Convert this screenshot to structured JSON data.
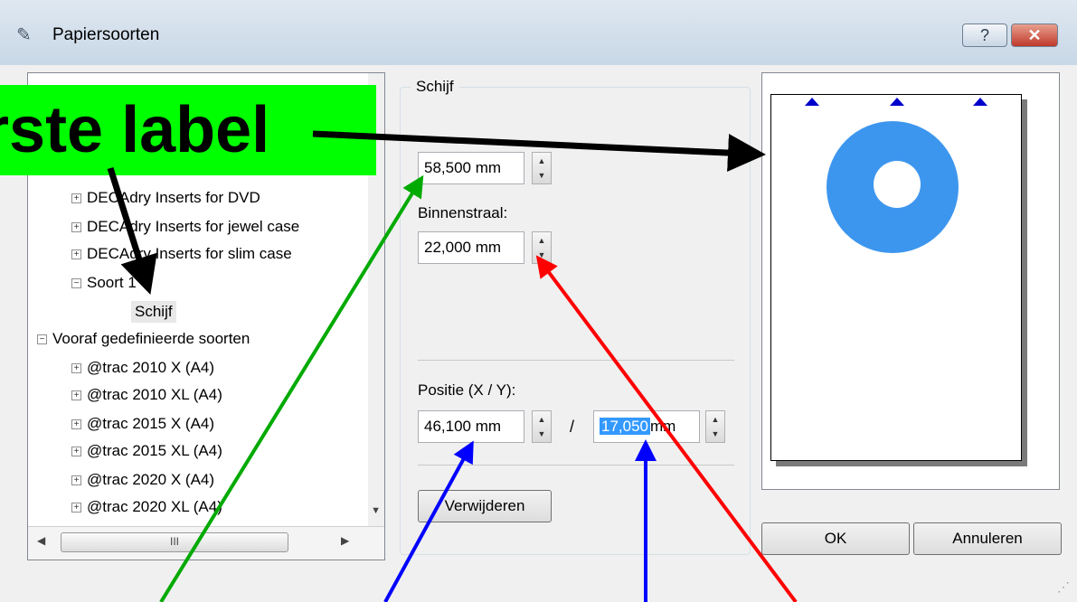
{
  "window": {
    "title": "Papiersoorten",
    "help_label": "?",
    "close_label": "✕"
  },
  "tree": {
    "items": [
      {
        "label": "DECAdry Inserts for DVD"
      },
      {
        "label": "DECAdry Inserts for jewel case"
      },
      {
        "label": "DECAdry Inserts for slim case"
      },
      {
        "label": "Soort 1"
      },
      {
        "label": "Schijf"
      },
      {
        "label": "Vooraf gedefinieerde soorten"
      },
      {
        "label": "@trac 2010 X (A4)"
      },
      {
        "label": "@trac 2010 XL (A4)"
      },
      {
        "label": "@trac 2015 X (A4)"
      },
      {
        "label": "@trac 2015 XL (A4)"
      },
      {
        "label": "@trac 2020 X (A4)"
      },
      {
        "label": "@trac 2020 XL (A4)"
      }
    ],
    "hscroll_thumb": "III"
  },
  "group": {
    "title": "Schijf",
    "outer_radius": {
      "value": "58,500 mm"
    },
    "inner_radius": {
      "label": "Binnenstraal:",
      "value": "22,000 mm"
    },
    "position": {
      "label": "Positie (X / Y):",
      "x": "46,100 mm",
      "y_selected": "17,050",
      "y_rest": "mm",
      "separator": "/"
    },
    "delete_button": "Verwijderen"
  },
  "buttons": {
    "ok": "OK",
    "cancel": "Annuleren"
  },
  "annotation": {
    "callout_text": "rste label",
    "callout_color": "#00ff00",
    "arrow_colors": {
      "black": "#000000",
      "green": "#00aa00",
      "blue": "#0000ff",
      "red": "#ff0000"
    }
  },
  "preview": {
    "disc_color": "#3d96ee",
    "marker_color": "#0000cc"
  }
}
